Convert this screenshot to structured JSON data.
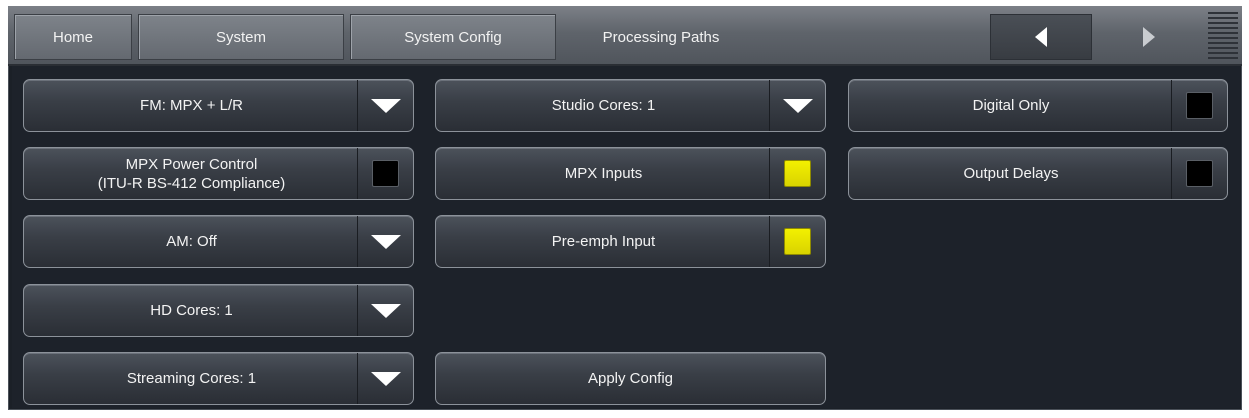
{
  "nav": {
    "tabs": [
      {
        "label": "Home"
      },
      {
        "label": "System"
      },
      {
        "label": "System Config"
      },
      {
        "label": "Processing Paths"
      }
    ],
    "prev_icon": "triangle-left-icon",
    "next_icon": "triangle-right-icon",
    "menu_icon": "menu-lines-icon"
  },
  "colors": {
    "background": "#1d222a",
    "toggle_on": "#f0eb00",
    "toggle_off": "#000000"
  },
  "buttons": {
    "fm": {
      "label": "FM: MPX + L/R",
      "icon": "dropdown-arrow-icon"
    },
    "mpx_power": {
      "line1": "MPX Power Control",
      "line2": "(ITU-R BS-412 Compliance)",
      "state": "off"
    },
    "am": {
      "label": "AM: Off",
      "icon": "dropdown-arrow-icon"
    },
    "hd_cores": {
      "label": "HD Cores: 1",
      "icon": "dropdown-arrow-icon"
    },
    "streaming_cores": {
      "label": "Streaming Cores: 1",
      "icon": "dropdown-arrow-icon"
    },
    "studio_cores": {
      "label": "Studio Cores: 1",
      "icon": "dropdown-arrow-icon"
    },
    "mpx_inputs": {
      "label": "MPX Inputs",
      "state": "on"
    },
    "pre_emph": {
      "label": "Pre-emph Input",
      "state": "on"
    },
    "apply_config": {
      "label": "Apply Config"
    },
    "digital_only": {
      "label": "Digital Only",
      "state": "off"
    },
    "output_delays": {
      "label": "Output Delays",
      "state": "off"
    }
  }
}
